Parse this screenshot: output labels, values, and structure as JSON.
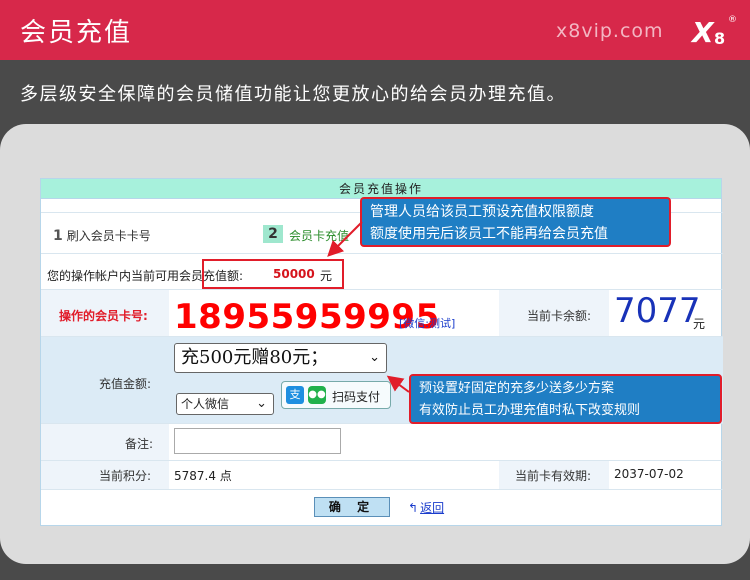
{
  "header": {
    "title": "会员充值",
    "site": "x8vip.com",
    "logo_text": "X8",
    "logo_mark": "®"
  },
  "subtitle": "多层级安全保障的会员储值功能让您更放心的给会员办理充值。",
  "form": {
    "heading": "会员充值操作",
    "step1_num": "1",
    "step1_label": "刷入会员卡卡号",
    "step2_num": "2",
    "step2_label": "会员卡充值",
    "balance_label": "您的操作帐户内当前可用会员充值额:",
    "balance_value": "50000",
    "balance_unit": "元",
    "card_label": "操作的会员卡号:",
    "card_number": "18955959995",
    "card_tag": "[微信:测试]",
    "card_balance_label": "当前卡余额:",
    "card_balance_value": "7077",
    "card_balance_unit": "元",
    "amount_label": "充值金额:",
    "amount_selected": "充500元赠80元；",
    "pay_method_selected": "个人微信",
    "scan_pay_label": "扫码支付",
    "remark_label": "备注:",
    "remark_value": "",
    "points_label": "当前积分:",
    "points_value": "5787.4 点",
    "expiry_label": "当前卡有效期:",
    "expiry_value": "2037-07-02",
    "confirm_label": "确 定",
    "back_label": "返回"
  },
  "annotations": {
    "note1_line1": "管理人员给该员工预设充值权限额度",
    "note1_line2": "额度使用完后该员工不能再给会员充值",
    "note2_line1": "预设置好固定的充多少送多少方案",
    "note2_line2": "有效防止员工办理充值时私下改变规则"
  },
  "colors": {
    "brand": "#d7284a",
    "header_green": "#a7f1dc",
    "note_blue": "#1f7ec4",
    "highlight_red": "#e11d2a"
  }
}
